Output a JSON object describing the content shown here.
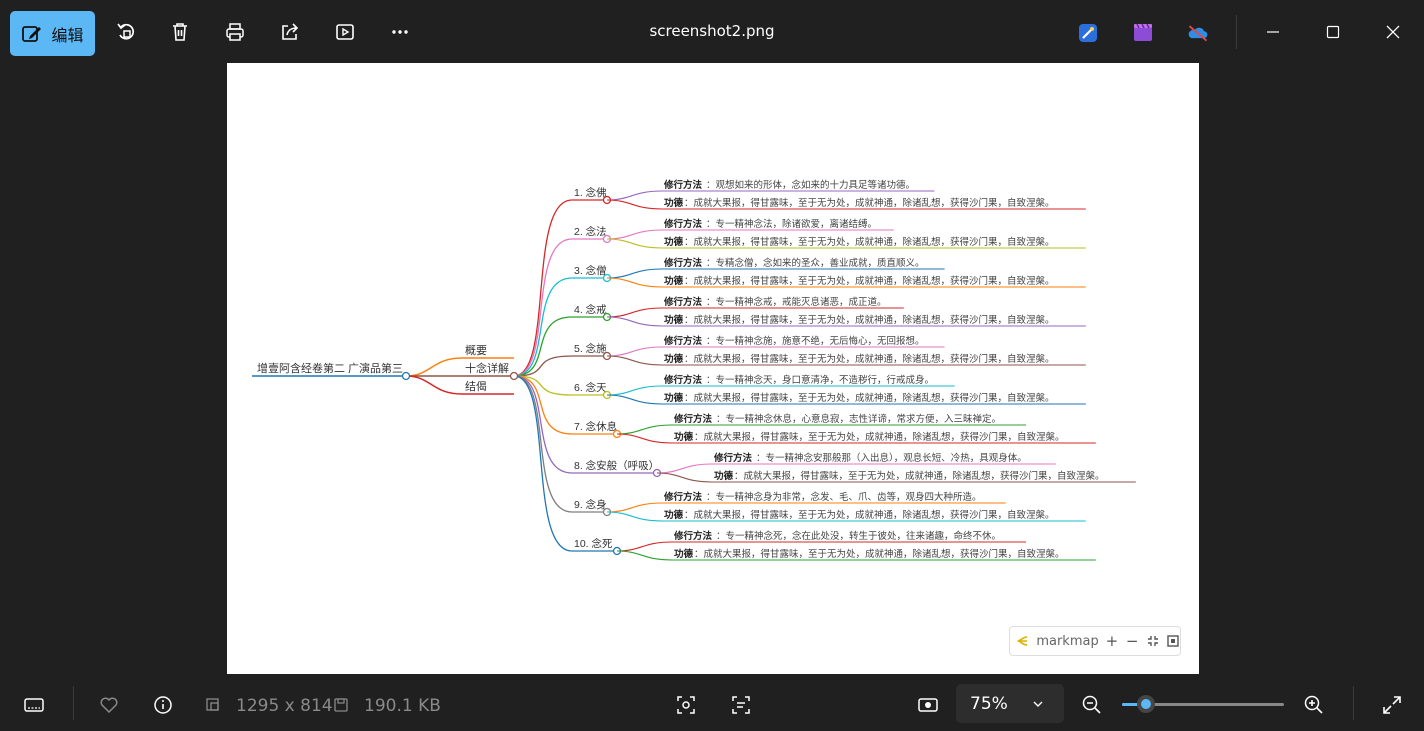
{
  "toolbar": {
    "edit_label": "编辑",
    "icons": [
      "edit-icon",
      "rotate-icon",
      "delete-icon",
      "print-icon",
      "share-icon",
      "slideshow-icon",
      "more-icon"
    ]
  },
  "window": {
    "title": "screenshot2.png"
  },
  "mindmap": {
    "root": "增壹阿含经卷第二 广演品第三",
    "level1": [
      "概要",
      "十念详解",
      "结偈"
    ],
    "method_label": "修行方法",
    "merit_label": "功德",
    "items": [
      {
        "name": "1. 念佛",
        "method": "：观想如来的形体，念如来的十力具足等诸功德。",
        "merit": "：成就大果报，得甘露味，至于无为处，成就神通，除诸乱想，获得沙门果，自致涅槃。"
      },
      {
        "name": "2. 念法",
        "method": "：专一精神念法，除诸欲爱，离诸结缚。",
        "merit": "：成就大果报，得甘露味，至于无为处，成就神通，除诸乱想，获得沙门果，自致涅槃。"
      },
      {
        "name": "3. 念僧",
        "method": "：专精念僧，念如来的圣众，善业成就，质直顺义。",
        "merit": "：成就大果报，得甘露味，至于无为处，成就神通，除诸乱想，获得沙门果，自致涅槃。"
      },
      {
        "name": "4. 念戒",
        "method": "：专一精神念戒，戒能灭息诸恶，成正道。",
        "merit": "：成就大果报，得甘露味，至于无为处，成就神通，除诸乱想，获得沙门果，自致涅槃。"
      },
      {
        "name": "5. 念施",
        "method": "：专一精神念施，施意不绝，无后悔心，无回报想。",
        "merit": "：成就大果报，得甘露味，至于无为处，成就神通，除诸乱想，获得沙门果，自致涅槃。"
      },
      {
        "name": "6. 念天",
        "method": "：专一精神念天，身口意清净，不造秽行，行戒成身。",
        "merit": "：成就大果报，得甘露味，至于无为处，成就神通，除诸乱想，获得沙门果，自致涅槃。"
      },
      {
        "name": "7. 念休息",
        "method": "：专一精神念休息，心意息寂，志性详谛，常求方便，入三昧禅定。",
        "merit": "：成就大果报，得甘露味，至于无为处，成就神通，除诸乱想，获得沙门果，自致涅槃。"
      },
      {
        "name": "8. 念安般（呼吸）",
        "method": "：专一精神念安那般那（入出息），观息长短、冷热，具观身体。",
        "merit": "：成就大果报，得甘露味，至于无为处，成就神通，除诸乱想，获得沙门果，自致涅槃。"
      },
      {
        "name": "9. 念身",
        "method": "：专一精神念身为非常，念发、毛、爪、齿等，观身四大种所造。",
        "merit": "：成就大果报，得甘露味，至于无为处，成就神通，除诸乱想，获得沙门果，自致涅槃。"
      },
      {
        "name": "10. 念死",
        "method": "：专一精神念死，念在此处没，转生于彼处，往来诸趣，命终不休。",
        "merit": "：成就大果报，得甘露味，至于无为处，成就神通，除诸乱想，获得沙门果，自致涅槃。"
      }
    ],
    "colors": [
      "#d62728",
      "#e377c2",
      "#17becf",
      "#2ca02c",
      "#8c564b",
      "#bcbd22",
      "#ff7f0e",
      "#9467bd",
      "#7f7f7f",
      "#1f77b4"
    ],
    "sub_colors": [
      "#9467bd",
      "#d62728",
      "#e377c2",
      "#bcbd22",
      "#1f77b4",
      "#ff7f0e",
      "#d62728",
      "#9467bd",
      "#e377c2",
      "#8c564b",
      "#17becf",
      "#1f77b4",
      "#2ca02c",
      "#d62728",
      "#e377c2",
      "#8c564b",
      "#ff7f0e",
      "#17becf",
      "#d62728",
      "#2ca02c"
    ]
  },
  "markmap": {
    "label": "markmap",
    "zoom_in": "+",
    "zoom_out": "−"
  },
  "bottombar": {
    "dimensions": "1295 x 814",
    "filesize": "190.1 KB",
    "zoom": "75%",
    "zoom_level": 0.15
  },
  "colors": {
    "accent": "#5cb7f5",
    "background": "#202020"
  }
}
